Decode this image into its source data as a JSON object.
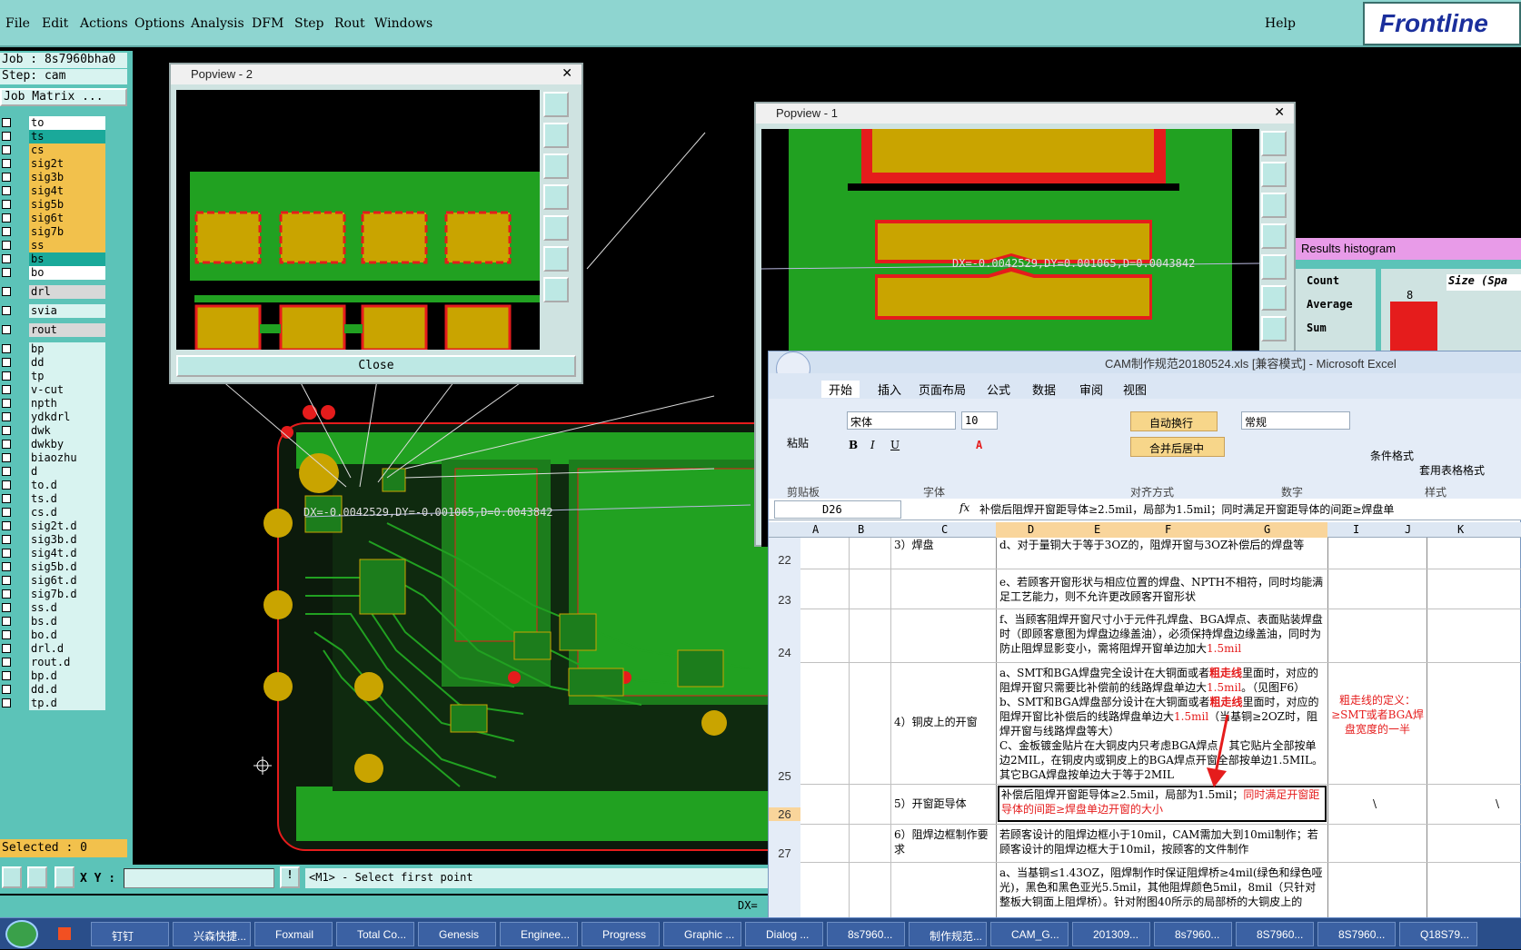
{
  "menu": {
    "file": "File",
    "edit": "Edit",
    "actions": "Actions",
    "options": "Options",
    "analysis": "Analysis",
    "dfm": "DFM",
    "step": "Step",
    "rout": "Rout",
    "windows": "Windows",
    "help": "Help"
  },
  "logo": "Frontline",
  "job": {
    "job_label": "Job : 8s7960bha0",
    "step_label": "Step: cam",
    "matrix_button": "Job Matrix ..."
  },
  "layers": [
    "to",
    "ts",
    "cs",
    "sig2t",
    "sig3b",
    "sig4t",
    "sig5b",
    "sig6t",
    "sig7b",
    "ss",
    "bs",
    "bo",
    "drl",
    "svia",
    "rout",
    "bp",
    "dd",
    "tp",
    "v-cut",
    "npth",
    "ydkdrl",
    "dwk",
    "dwkby",
    "biaozhu",
    "d",
    "to.d",
    "ts.d",
    "cs.d",
    "sig2t.d",
    "sig3b.d",
    "sig4t.d",
    "sig5b.d",
    "sig6t.d",
    "sig7b.d",
    "ss.d",
    "bs.d",
    "bo.d",
    "drl.d",
    "rout.d",
    "bp.d",
    "dd.d",
    "tp.d"
  ],
  "selected": "Selected : 0",
  "xy_label": "X Y :",
  "prompt": "<M1> - Select first point",
  "measure_main": "DX=-0.0042529,DY=-0.001065,D=0.0043842",
  "measure_popview1": "DX=-0.0042529,DY=0.001065,D=0.0043842",
  "bottom_dx": "DX=",
  "popview2": {
    "title": "Popview - 2",
    "close": "Close"
  },
  "popview1": {
    "title": "Popview - 1"
  },
  "histogram": {
    "title": "Results histogram",
    "count": "Count",
    "average": "Average",
    "sum": "Sum",
    "size_label": "Size (Spa",
    "bar_value": "8"
  },
  "excel": {
    "title": "CAM制作规范20180524.xls [兼容模式] - Microsoft Excel",
    "tabs": [
      "开始",
      "插入",
      "页面布局",
      "公式",
      "数据",
      "审阅",
      "视图"
    ],
    "font_name": "宋体",
    "font_size": "10",
    "wrap": "自动换行",
    "merge": "合并后居中",
    "number_format": "常规",
    "cond_format": "条件格式",
    "table_format": "套用表格格式",
    "paste": "粘贴",
    "groups": [
      "剪贴板",
      "字体",
      "对齐方式",
      "数字",
      "样式"
    ],
    "name_box": "D26",
    "formula": "补偿后阻焊开窗距导体≥2.5mil，局部为1.5mil；同时满足开窗距导体的间距≥焊盘单",
    "columns": [
      "A",
      "B",
      "C",
      "D",
      "E",
      "F",
      "G",
      "I",
      "J",
      "K"
    ],
    "rows": {
      "r22": {
        "num": "22",
        "c": "3）焊盘",
        "d": "d、对于量铜大于等于3OZ的，阻焊开窗与3OZ补偿后的焊盘等大。"
      },
      "r23": {
        "num": "23",
        "d": "e、若顾客开窗形状与相应位置的焊盘、NPTH不相符，同时均能满足工艺能力，则不允许更改顾客开窗形状"
      },
      "r24": {
        "num": "24",
        "d1": "f、当顾客阻焊开窗尺寸小于元件孔焊盘、BGA焊点、表面贴装焊盘时（即顾客意图为焊盘边缘盖油），必须保持焊盘边缘盖油，同时为防止阻焊显影变小，需将阻焊开窗单边加大",
        "d2": "1.5mil"
      },
      "r25": {
        "num": "25",
        "c": "4）铜皮上的开窗",
        "a1": "a、SMT和BGA焊盘完全设计在大铜面或者",
        "a2": "粗走线",
        "a3": "里面时，对应的阻焊开窗只需要比补偿前的线路焊盘单边大",
        "a4": "1.5mil",
        "a5": "。（见图F6）",
        "b1": "b、SMT和BGA焊盘部分设计在大铜面或者",
        "b2": "粗走线",
        "b3": "里面时，对应的阻焊开窗比补偿后的线路焊盘单边大",
        "b4": "1.5mil",
        "b5": "（当基铜≥2OZ时，阻焊开窗与线路焊盘等大）",
        "c_line": "C、金板镀金贴片在大铜皮内只考虑BGA焊点，其它贴片全部按单边2MIL，在铜皮内或铜皮上的BGA焊点开窗全部按单边1.5MIL。其它BGA焊盘按单边大于等于2MIL",
        "i": "粗走线的定义：≥SMT或者BGA焊盘宽度的一半"
      },
      "r26": {
        "num": "26",
        "c": "5）开窗距导体",
        "d1": "补偿后阻焊开窗距导体≥2.5mil，局部为1.5mil；",
        "d2": "同时满足开窗距导体的间距≥焊盘单边开窗的大小",
        "i": "\\",
        "k": "\\"
      },
      "r27": {
        "num": "27",
        "c": "6）阻焊边框制作要求",
        "d": "若顾客设计的阻焊边框小于10mil，CAM需加大到10mil制作；若顾客设计的阻焊边框大于10mil，按顾客的文件制作"
      },
      "r28": {
        "d": "a、当基铜≤1.43OZ，阻焊制作时保证阻焊桥≥4mil(绿色和绿色哑光)，黑色和黑色亚光5.5mil，其他阻焊颜色5mil，8mil（只针对整板大铜面上阻焊桥）。针对附图40所示的局部桥的大铜皮上的"
      }
    }
  },
  "taskbar": [
    "钉钉",
    "兴森快捷...",
    "Foxmail",
    "Total Co...",
    "Genesis",
    "Enginee...",
    "Progress",
    "Graphic ...",
    "Dialog ...",
    "8s7960...",
    "制作规范...",
    "CAM_G...",
    "201309...",
    "8s7960...",
    "8S7960...",
    "8S7960...",
    "Q18S79..."
  ],
  "colors": {
    "teal": "#5cc3b8",
    "board_green": "#21a121",
    "pad_gold": "#c9a400",
    "pad_red": "#e51c1c"
  }
}
